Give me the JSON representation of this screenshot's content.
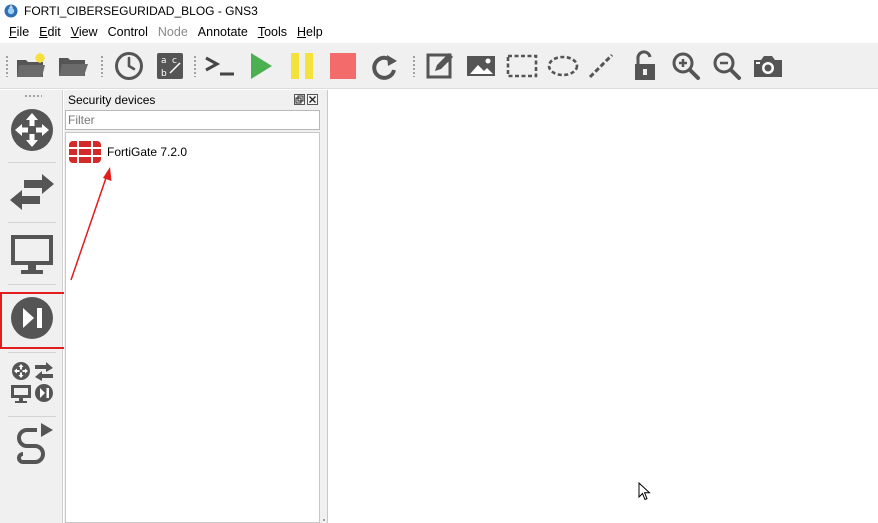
{
  "window": {
    "title": "FORTI_CIBERSEGURIDAD_BLOG - GNS3"
  },
  "menu": {
    "items": [
      {
        "label": "File",
        "mnemonic": "F",
        "rest": "ile",
        "enabled": true
      },
      {
        "label": "Edit",
        "mnemonic": "E",
        "rest": "dit",
        "enabled": true
      },
      {
        "label": "View",
        "mnemonic": "V",
        "rest": "iew",
        "enabled": true
      },
      {
        "label": "Control",
        "mnemonic": "",
        "rest": "Control",
        "enabled": true
      },
      {
        "label": "Node",
        "mnemonic": "",
        "rest": "Node",
        "enabled": false
      },
      {
        "label": "Annotate",
        "mnemonic": "",
        "rest": "Annotate",
        "enabled": true
      },
      {
        "label": "Tools",
        "mnemonic": "T",
        "rest": "ools",
        "enabled": true
      },
      {
        "label": "Help",
        "mnemonic": "H",
        "rest": "elp",
        "enabled": true
      }
    ]
  },
  "toolbar": {
    "buttons": [
      "new-project-icon",
      "open-project-icon",
      "snapshot-clock-icon",
      "show-interface-labels-icon",
      "console-icon",
      "start-all-icon",
      "suspend-all-icon",
      "stop-all-icon",
      "reload-all-icon",
      "add-note-icon",
      "insert-picture-icon",
      "draw-rectangle-icon",
      "draw-ellipse-icon",
      "draw-line-icon",
      "lock-icon",
      "zoom-in-icon",
      "zoom-out-icon",
      "screenshot-icon"
    ]
  },
  "dock": {
    "buttons": [
      "routers-icon",
      "switches-icon",
      "end-devices-icon",
      "security-devices-icon",
      "all-devices-icon",
      "add-link-icon"
    ]
  },
  "panel": {
    "title": "Security devices",
    "filter_placeholder": "Filter",
    "filter_value": "",
    "devices": [
      {
        "label": "FortiGate 7.2.0",
        "icon": "fortigate-icon"
      }
    ]
  },
  "colors": {
    "start_green": "#4caf50",
    "suspend_yellow": "#f4e13a",
    "stop_red": "#f36b6b",
    "fortinet_red": "#d42a2a",
    "annotation_red": "#e11d1d",
    "icon_gray": "#555555"
  }
}
